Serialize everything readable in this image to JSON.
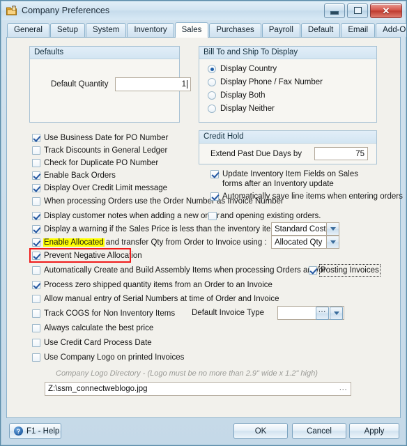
{
  "window": {
    "title": "Company Preferences",
    "icon": "company-folder-icon",
    "minimize_label": "Minimize",
    "maximize_label": "Maximize",
    "close_label": "Close",
    "border_color": "#5b8ba8"
  },
  "tabs": [
    {
      "label": "General",
      "active": false
    },
    {
      "label": "Setup",
      "active": false
    },
    {
      "label": "System",
      "active": false
    },
    {
      "label": "Inventory",
      "active": false
    },
    {
      "label": "Sales",
      "active": true
    },
    {
      "label": "Purchases",
      "active": false
    },
    {
      "label": "Payroll",
      "active": false
    },
    {
      "label": "Default",
      "active": false
    },
    {
      "label": "Email",
      "active": false
    },
    {
      "label": "Add-Ons",
      "active": false
    }
  ],
  "defaults_group": {
    "title": "Defaults",
    "quantity_label": "Default Quantity",
    "quantity_value": "1"
  },
  "bill_ship_group": {
    "title": "Bill To and Ship To Display",
    "options": [
      {
        "label": "Display Country",
        "selected": true
      },
      {
        "label": "Display Phone / Fax Number",
        "selected": false
      },
      {
        "label": "Display Both",
        "selected": false
      },
      {
        "label": "Display Neither",
        "selected": false
      }
    ]
  },
  "credit_hold_group": {
    "title": "Credit Hold",
    "extend_label": "Extend Past Due Days by",
    "extend_value": "75"
  },
  "right_checkboxes": [
    {
      "label": "Update Inventory Item Fields on Sales forms after an Inventory update",
      "checked": true
    },
    {
      "label": "Automatically save line items when entering orders",
      "checked": true
    }
  ],
  "left_checkboxes": [
    {
      "label": "Use Business Date for PO Number",
      "checked": true
    },
    {
      "label": "Track Discounts in General Ledger",
      "checked": false
    },
    {
      "label": "Check for Duplicate PO Number",
      "checked": false
    },
    {
      "label": "Enable Back Orders",
      "checked": true
    },
    {
      "label": "Display Over Credit Limit message",
      "checked": true
    },
    {
      "label": "When processing Orders use the Order Number as Invoice Number",
      "checked": false
    }
  ],
  "customer_notes": {
    "label": "Display customer notes when adding a new order",
    "checked": true,
    "secondary_label": "and opening existing orders.",
    "secondary_checked": false
  },
  "sales_price_warning": {
    "label": "Display a warning if the Sales Price is less than the inventory items",
    "checked": true,
    "dropdown_value": "Standard Cost"
  },
  "enable_allocated": {
    "highlight_text": "Enable Allocated",
    "rest_text": " and transfer Qty from Order to Invoice using :",
    "checked": true,
    "highlight_color": "#ffff00",
    "dropdown_value": "Allocated Qty"
  },
  "prevent_negative": {
    "label": "Prevent Negative Allocation",
    "checked": true,
    "outline_color": "#ef1b1b"
  },
  "assembly_items": {
    "label": "Automatically Create and Build Assembly Items when processing Orders and/or",
    "checked": false,
    "posting_label": "Posting Invoices",
    "posting_checked": true,
    "posting_focused": true
  },
  "lower_checkboxes": [
    {
      "label": "Process zero shipped quantity items from an Order to an Invoice",
      "checked": true
    },
    {
      "label": "Allow manual entry of Serial Numbers at time of Order and Invoice",
      "checked": false
    },
    {
      "label": "Track COGS for Non Inventory Items",
      "checked": false
    },
    {
      "label": "Always calculate the best price",
      "checked": false
    },
    {
      "label": "Use Credit Card Process Date",
      "checked": false
    },
    {
      "label": "Use Company Logo on printed Invoices",
      "checked": false
    }
  ],
  "invoice_type": {
    "label": "Default Invoice Type",
    "value": "",
    "browse_icon": "ellipsis-icon",
    "dropdown_icon": "chevron-down-icon"
  },
  "company_logo": {
    "note": "Company Logo Directory - (Logo must be no more than 2.9\" wide x 1.2\" high)",
    "path": "Z:\\ssm_connectweblogo.jpg",
    "browse_icon": "ellipsis-icon"
  },
  "footer": {
    "help_label": "F1 - Help",
    "help_icon": "question-circle-icon",
    "ok_label": "OK",
    "cancel_label": "Cancel",
    "apply_label": "Apply"
  }
}
